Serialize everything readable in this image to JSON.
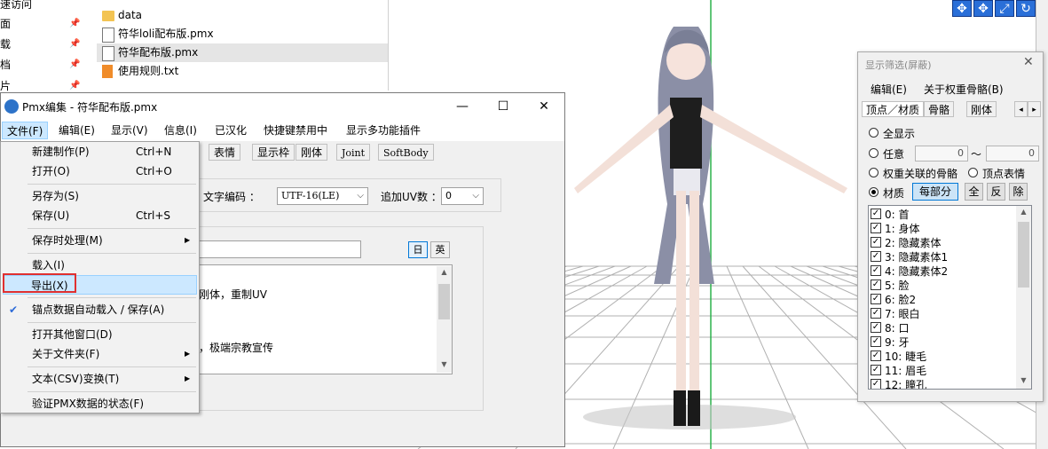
{
  "explorer": {
    "nav": [
      "速访问",
      "面",
      "载",
      "档",
      "片"
    ],
    "files": [
      {
        "name": "data",
        "type": "folder"
      },
      {
        "name": "符华loli配布版.pmx",
        "type": "file"
      },
      {
        "name": "符华配布版.pmx",
        "type": "file",
        "selected": true
      },
      {
        "name": "使用规则.txt",
        "type": "txt"
      }
    ]
  },
  "pmx": {
    "title": "Pmx编集 - 符华配布版.pmx",
    "window_buttons": {
      "minimize": "—",
      "maximize": "☐",
      "close": "✕"
    },
    "menu": [
      "文件(F)",
      "编辑(E)",
      "显示(V)",
      "信息(I)",
      "已汉化",
      "快捷键禁用中",
      "显示多功能插件"
    ],
    "tabs": [
      "表情",
      "显示枠",
      "刚体",
      "Joint",
      "SoftBody"
    ],
    "encoding_label": "文字编码 ：",
    "encoding_value": "UTF-16(LE)",
    "uv_label": "追加UV数 ：",
    "uv_value": "0",
    "lang_buttons": [
      "日",
      "英"
    ],
    "comment_fragment_1": "刚体，重制UV",
    "comment_fragment_2": "，极端宗教宣传"
  },
  "file_menu": [
    {
      "label": "新建制作(P)",
      "shortcut": "Ctrl+N"
    },
    {
      "label": "打开(O)",
      "shortcut": "Ctrl+O"
    },
    {
      "label": "另存为(S)",
      "shortcut": ""
    },
    {
      "label": "保存(U)",
      "shortcut": "Ctrl+S"
    },
    {
      "label": "保存时处理(M)",
      "submenu": true
    },
    {
      "label": "载入(I)"
    },
    {
      "label": "导出(X)",
      "highlighted": true
    },
    {
      "label": "锚点数据自动载入 / 保存(A)",
      "checked": true
    },
    {
      "label": "打开其他窗口(D)"
    },
    {
      "label": "关于文件夹(F)",
      "submenu": true
    },
    {
      "label": "文本(CSV)变换(T)",
      "submenu": true
    },
    {
      "label": "验证PMX数据的状态(F)"
    }
  ],
  "filter": {
    "title": "显示筛选(屏蔽)",
    "close": "✕",
    "menu": [
      "编辑(E)",
      "关于权重骨骼(B)"
    ],
    "tabs": [
      "顶点／材质",
      "骨骼",
      "刚体"
    ],
    "tab_scroll": [
      "◂",
      "▸"
    ],
    "opt_all": "全显示",
    "opt_any": "任意",
    "range_from": "0",
    "range_sep": "～",
    "range_to": "0",
    "opt_weight": "权重关联的骨骼",
    "opt_vertex_morph": "顶点表情",
    "opt_material": "材质",
    "btn_each": "每部分",
    "btn_all": "全",
    "btn_invert": "反",
    "btn_remove": "除",
    "materials": [
      "0: 首",
      "1: 身体",
      "2: 隐藏素体",
      "3: 隐藏素体1",
      "4: 隐藏素体2",
      "5: 脸",
      "6: 脸2",
      "7: 眼白",
      "8: 口",
      "9: 牙",
      "10: 睫毛",
      "11: 眉毛",
      "12: 瞳孔"
    ]
  },
  "colors": {
    "accent": "#0078d7",
    "highlight": "#cce8ff",
    "export_outline": "#e03030",
    "tool_blue": "#2a6fd8"
  }
}
